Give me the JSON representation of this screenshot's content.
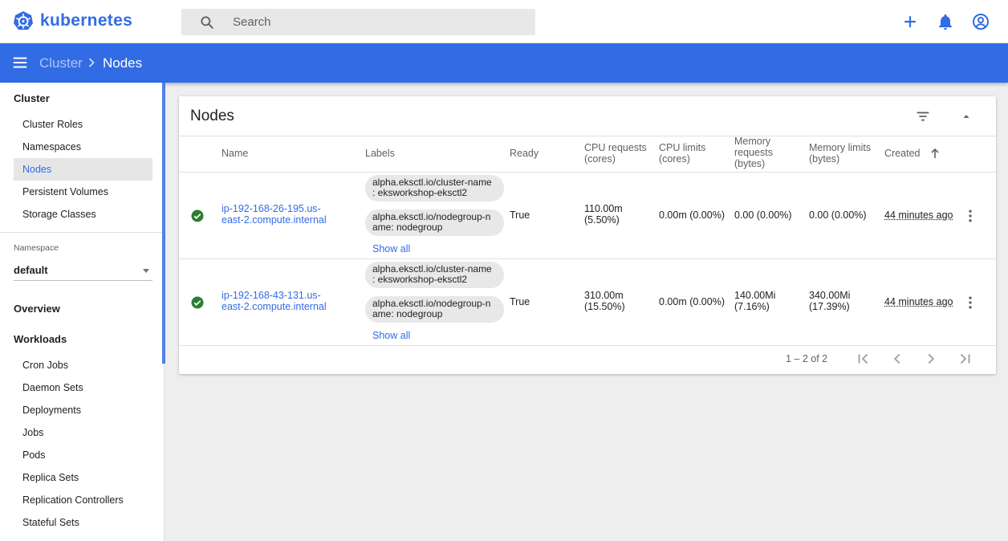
{
  "header": {
    "logo_text": "kubernetes",
    "search_placeholder": "Search"
  },
  "breadcrumb": {
    "parent": "Cluster",
    "current": "Nodes"
  },
  "sidebar": {
    "cluster_heading": "Cluster",
    "cluster_items": [
      "Cluster Roles",
      "Namespaces",
      "Nodes",
      "Persistent Volumes",
      "Storage Classes"
    ],
    "active_item": "Nodes",
    "namespace_label": "Namespace",
    "namespace_value": "default",
    "overview_heading": "Overview",
    "workloads_heading": "Workloads",
    "workload_items": [
      "Cron Jobs",
      "Daemon Sets",
      "Deployments",
      "Jobs",
      "Pods",
      "Replica Sets",
      "Replication Controllers",
      "Stateful Sets"
    ]
  },
  "nodes_card": {
    "title": "Nodes",
    "columns": {
      "name": "Name",
      "labels": "Labels",
      "ready": "Ready",
      "cpu_requests": [
        "CPU requests",
        "(cores)"
      ],
      "cpu_limits": [
        "CPU limits",
        "(cores)"
      ],
      "memory_requests": [
        "Memory",
        "requests",
        "(bytes)"
      ],
      "memory_limits": [
        "Memory limits",
        "(bytes)"
      ],
      "created": "Created"
    },
    "rows": [
      {
        "name": [
          "ip-192-168-26-195.us-",
          "east-2.compute.internal"
        ],
        "labels": [
          [
            "alpha.eksctl.io/cluster-name",
            ": eksworkshop-eksctl2"
          ],
          [
            "alpha.eksctl.io/nodegroup-n",
            "ame: nodegroup"
          ]
        ],
        "show_all": "Show all",
        "ready": "True",
        "cpu_requests": [
          "110.00m",
          "(5.50%)"
        ],
        "cpu_limits": "0.00m (0.00%)",
        "memory_requests": "0.00 (0.00%)",
        "memory_limits": "0.00 (0.00%)",
        "created": "44 minutes ago"
      },
      {
        "name": [
          "ip-192-168-43-131.us-",
          "east-2.compute.internal"
        ],
        "labels": [
          [
            "alpha.eksctl.io/cluster-name",
            ": eksworkshop-eksctl2"
          ],
          [
            "alpha.eksctl.io/nodegroup-n",
            "ame: nodegroup"
          ]
        ],
        "show_all": "Show all",
        "ready": "True",
        "cpu_requests": [
          "310.00m",
          "(15.50%)"
        ],
        "cpu_limits": "0.00m (0.00%)",
        "memory_requests": [
          "140.00Mi",
          "(7.16%)"
        ],
        "memory_limits": [
          "340.00Mi",
          "(17.39%)"
        ],
        "created": "44 minutes ago"
      }
    ],
    "pagination": "1 – 2 of 2"
  },
  "colors": {
    "brand": "#326ce5",
    "ready_green": "#2e7d32"
  },
  "icons": [
    "kubernetes-logo-icon",
    "search-icon",
    "add-icon",
    "bell-icon",
    "account-icon",
    "menu-icon",
    "chevron-right-icon",
    "filter-icon",
    "collapse-icon",
    "arrow-up-icon",
    "check-circle-icon",
    "more-vert-icon",
    "first-page-icon",
    "prev-page-icon",
    "next-page-icon",
    "last-page-icon"
  ]
}
